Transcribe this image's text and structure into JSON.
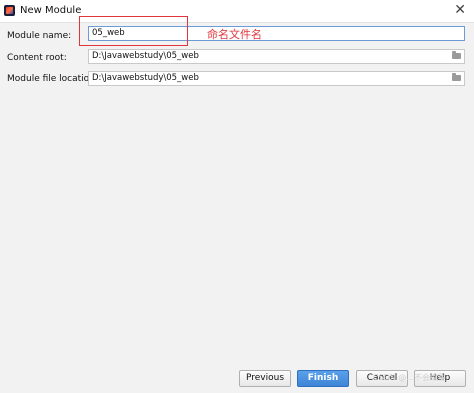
{
  "window": {
    "title": "New Module",
    "app_icon": "intellij-icon",
    "close_glyph": "✕"
  },
  "form": {
    "module_name": {
      "label": "Module name:",
      "value": "05_web"
    },
    "content_root": {
      "label": "Content root:",
      "value": "D:\\Javawebstudy\\05_web"
    },
    "module_file_location": {
      "label": "Module file location:",
      "value": "D:\\Javawebstudy\\05_web"
    }
  },
  "annotation": {
    "text": "命名文件名",
    "color": "#e0363b"
  },
  "buttons": {
    "previous": "Previous",
    "finish": "Finish",
    "cancel": "Cancel",
    "help": "Help"
  },
  "watermark": "CSDN @...不会编程"
}
